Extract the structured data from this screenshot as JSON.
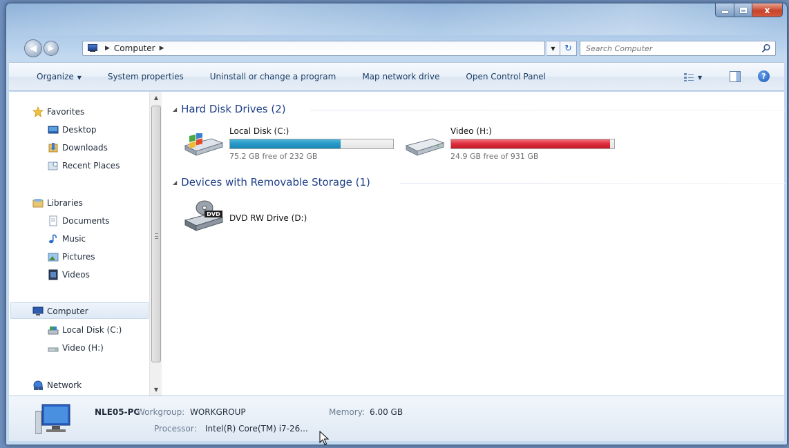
{
  "window": {
    "caption": {
      "minimize": "",
      "maximize": "",
      "close": "x"
    }
  },
  "address": {
    "crumbs": [
      "Computer"
    ],
    "search_placeholder": "Search Computer"
  },
  "commands": {
    "organize": "Organize",
    "system_properties": "System properties",
    "uninstall": "Uninstall or change a program",
    "map_network": "Map network drive",
    "control_panel": "Open Control Panel",
    "help": "?"
  },
  "nav": {
    "favorites": "Favorites",
    "desktop": "Desktop",
    "downloads": "Downloads",
    "recent_places": "Recent Places",
    "libraries": "Libraries",
    "documents": "Documents",
    "music": "Music",
    "pictures": "Pictures",
    "videos": "Videos",
    "computer": "Computer",
    "local_disk": "Local Disk (C:)",
    "video_drive": "Video (H:)",
    "network": "Network"
  },
  "groups": {
    "hard_disks": "Hard Disk Drives (2)",
    "removable": "Devices with Removable Storage (1)"
  },
  "drives": [
    {
      "name": "Local Disk (C:)",
      "free_text": "75.2 GB free of 232 GB",
      "used_fraction": 0.676,
      "color": "#2799c7"
    },
    {
      "name": "Video (H:)",
      "free_text": "24.9 GB free of 931 GB",
      "used_fraction": 0.973,
      "color": "#dd2c3a"
    }
  ],
  "removable_drive": {
    "name": "DVD RW Drive (D:)",
    "icon_label": "DVD"
  },
  "details": {
    "pc_name": "NLE05-PC",
    "workgroup_label": "Workgroup:",
    "workgroup_value": "WORKGROUP",
    "memory_label": "Memory:",
    "memory_value": "6.00 GB",
    "processor_label": "Processor:",
    "processor_value": "Intel(R) Core(TM) i7-26..."
  }
}
